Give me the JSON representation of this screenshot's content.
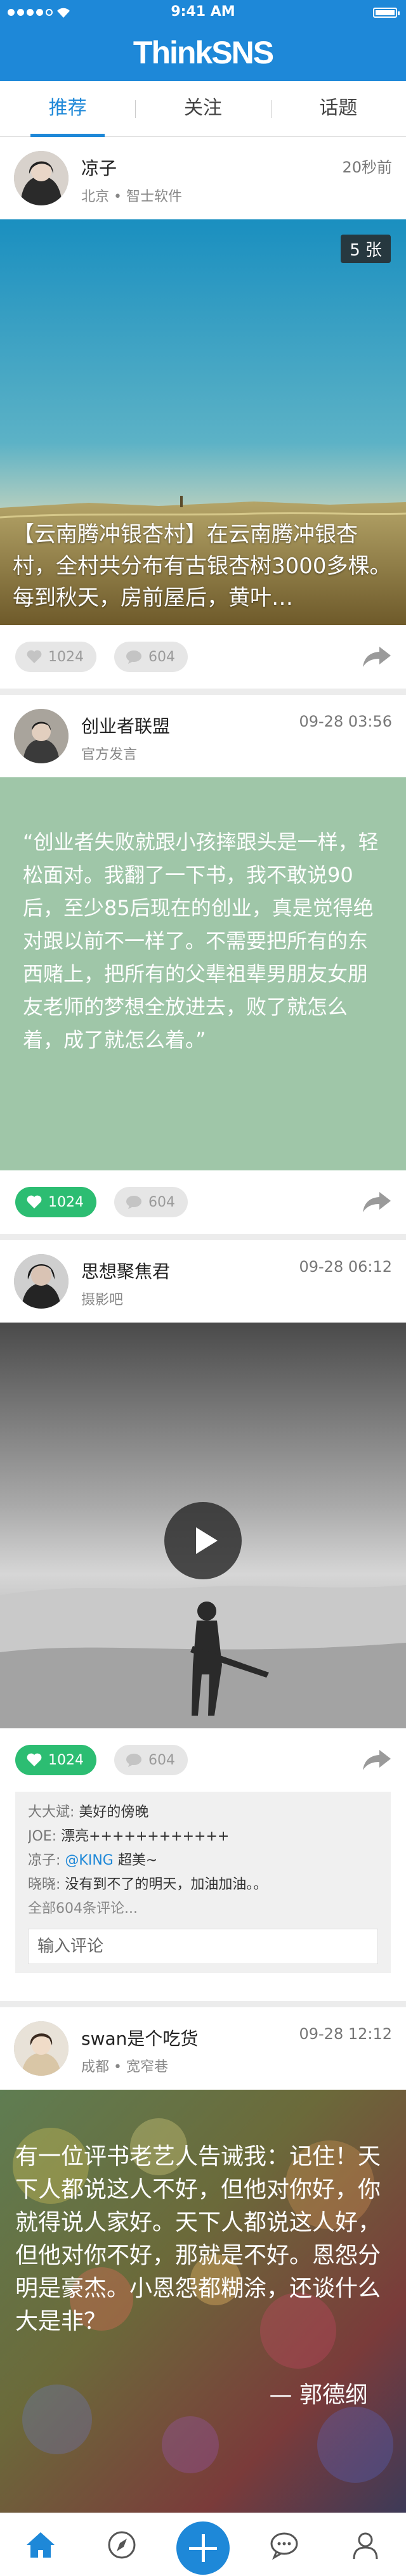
{
  "status_bar": {
    "time": "9:41 AM"
  },
  "app": {
    "title": "ThinkSNS"
  },
  "tabs": [
    {
      "label": "推荐"
    },
    {
      "label": "关注"
    },
    {
      "label": "话题"
    }
  ],
  "posts": [
    {
      "author": "凉子",
      "subtitle": "北京 • 智士软件",
      "time": "20秒前",
      "image_count": "5 张",
      "caption": "【云南腾冲银杏村】在云南腾冲银杏村，全村共分布有古银杏树3000多棵。每到秋天，房前屋后，黄叶…",
      "likes": "1024",
      "comments_count": "604",
      "liked": false
    },
    {
      "author": "创业者联盟",
      "subtitle": "官方发言",
      "time": "09-28 03:56",
      "quote": "“创业者失败就跟小孩摔跟头是一样，轻松面对。我翻了一下书，我不敢说90后，至少85后现在的创业，真是觉得绝对跟以前不一样了。不需要把所有的东西赌上，把所有的父辈祖辈男朋友女朋友老师的梦想全放进去，败了就怎么着，成了就怎么着。”",
      "likes": "1024",
      "comments_count": "604",
      "liked": true
    },
    {
      "author": "思想聚焦君",
      "subtitle": "摄影吧",
      "time": "09-28 06:12",
      "likes": "1024",
      "comments_count": "604",
      "liked": true,
      "comment_list": [
        {
          "user": "大大斌:",
          "text": "美好的傍晚"
        },
        {
          "user": "JOE:",
          "text": "漂亮++++++++++++"
        },
        {
          "user": "凉子:",
          "mention": "@KING",
          "text": " 超美~"
        },
        {
          "user": "晓晓:",
          "text": "没有到不了的明天，加油加油。。"
        }
      ],
      "all_comments": "全部604条评论...",
      "input_placeholder": "输入评论"
    },
    {
      "author": "swan是个吃货",
      "subtitle": "成都 • 宽窄巷",
      "time": "09-28 12:12",
      "quote": "有一位评书老艺人告诫我：记住！天下人都说这人不好，但他对你好，你就得说人家好。天下人都说这人好，但他对你不好，那就是不好。恩怨分明是豪杰。小恩怨都糊涂，还谈什么大是非？",
      "quote_author": "— 郭德纲"
    }
  ],
  "colors": {
    "brand": "#1e88d8",
    "like_active": "#2cbd72",
    "quote_bg": "#9fc6a8"
  },
  "bottom_nav": [
    {
      "icon": "home-icon"
    },
    {
      "icon": "compass-icon"
    },
    {
      "icon": "plus-icon"
    },
    {
      "icon": "message-icon"
    },
    {
      "icon": "profile-icon"
    }
  ]
}
